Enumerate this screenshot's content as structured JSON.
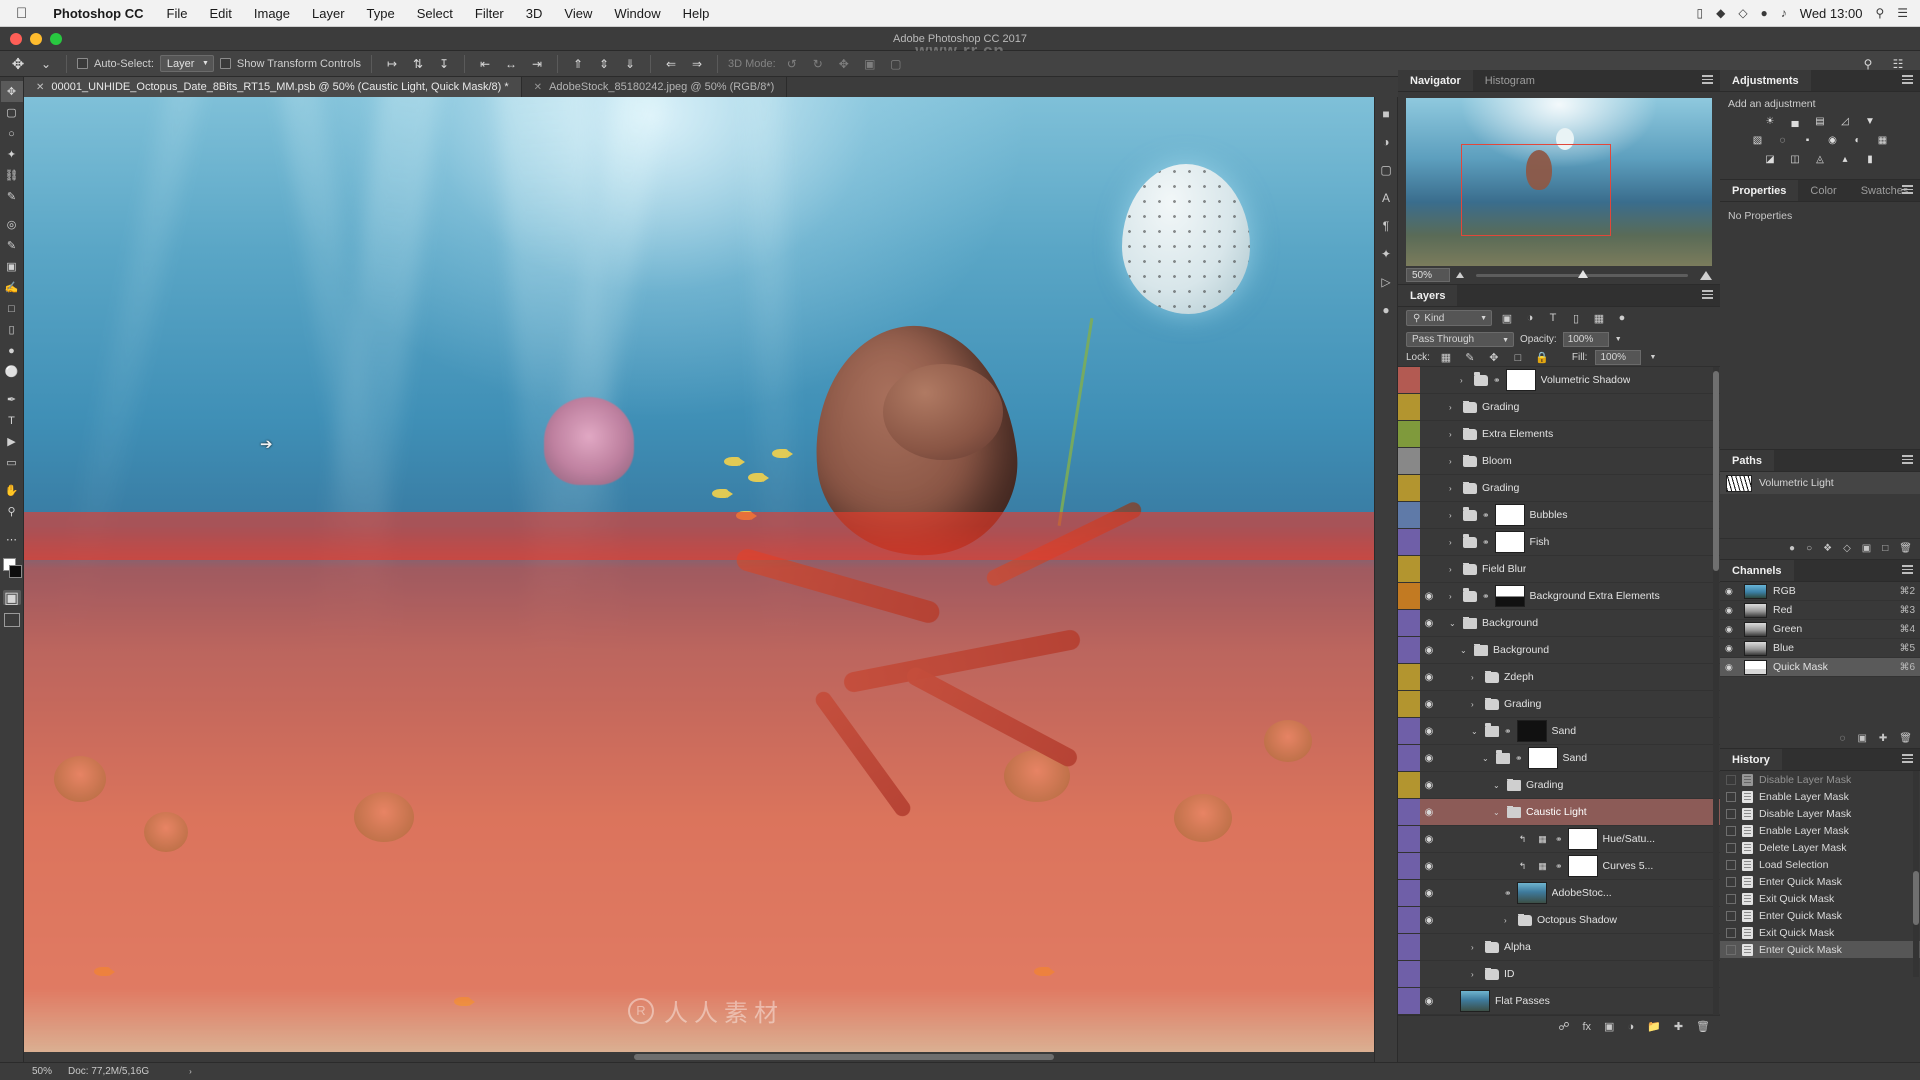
{
  "mac_menu": {
    "apple": "apple-logo",
    "app_name": "Photoshop CC",
    "items": [
      "File",
      "Edit",
      "Image",
      "Layer",
      "Type",
      "Select",
      "Filter",
      "3D",
      "View",
      "Window",
      "Help"
    ],
    "clock": "Wed 13:00",
    "status_icons": [
      "battery-icon",
      "wifi-icon",
      "volume-icon",
      "bluetooth-icon",
      "search-icon",
      "control-center-icon"
    ]
  },
  "window": {
    "title": "Adobe Photoshop CC 2017",
    "watermark_top": "www.rr.cn"
  },
  "options_bar": {
    "tool_icon": "move-tool-icon",
    "preset_caret": "chevron-down-icon",
    "auto_select_label": "Auto-Select:",
    "auto_select_value": "Layer",
    "show_transform_label": "Show Transform Controls",
    "align_icons": [
      "align-top-edges-icon",
      "align-vertical-centers-icon",
      "align-bottom-edges-icon",
      "align-left-edges-icon",
      "align-horizontal-centers-icon",
      "align-right-edges-icon",
      "distribute-top-icon",
      "distribute-vertical-center-icon",
      "distribute-bottom-icon",
      "distribute-left-icon",
      "distribute-right-icon"
    ],
    "mode_3d_label": "3D Mode:",
    "mode_3d_icons": [
      "rotate-3d-icon",
      "roll-3d-icon",
      "drag-3d-icon",
      "slide-3d-icon",
      "scale-3d-icon"
    ],
    "right_icons": [
      "search-icon",
      "workspace-icon"
    ]
  },
  "document_tabs": [
    {
      "name": "00001_UNHIDE_Octopus_Date_8Bits_RT15_MM.psb @ 50% (Caustic Light, Quick Mask/8) *",
      "active": true
    },
    {
      "name": "AdobeStock_85180242.jpeg @ 50% (RGB/8*)",
      "active": false
    }
  ],
  "toolbar": {
    "tools": [
      "move-tool",
      "rectangular-marquee-tool",
      "lasso-tool",
      "quick-selection-tool",
      "crop-tool",
      "eyedropper-tool",
      "spot-healing-brush-tool",
      "brush-tool",
      "clone-stamp-tool",
      "history-brush-tool",
      "eraser-tool",
      "gradient-tool",
      "blur-tool",
      "dodge-tool",
      "pen-tool",
      "type-tool",
      "path-selection-tool",
      "rectangle-tool",
      "hand-tool",
      "zoom-tool",
      "edit-toolbar"
    ],
    "foreground_color": "#ffffff",
    "background_color": "#0d0d0d",
    "quick_mask_mode": "quick-mask-toggle",
    "screen_mode": "screen-mode-toggle"
  },
  "canvas": {
    "watermark": "人人素材",
    "watermark_mark": "R",
    "quick_mask_color": "#ec3a2a"
  },
  "dock_icons": [
    "color-panel-icon",
    "adjustments-panel-icon",
    "libraries-panel-icon",
    "character-panel-icon",
    "paragraph-panel-icon",
    "styles-panel-icon",
    "actions-panel-icon",
    "brush-panel-icon"
  ],
  "navigator": {
    "tabs": [
      {
        "label": "Navigator",
        "active": true
      },
      {
        "label": "Histogram",
        "active": false
      }
    ],
    "zoom_level": "50%",
    "zoom_out_icon": "zoom-out-icon",
    "zoom_in_icon": "zoom-in-icon",
    "view_box_color": "#e2473a"
  },
  "layers_panel": {
    "title": "Layers",
    "filter_label": "Kind",
    "filter_icons": [
      "filter-pixel-icon",
      "filter-adjustment-icon",
      "filter-type-icon",
      "filter-shape-icon",
      "filter-smartobject-icon",
      "filter-toggle-icon"
    ],
    "blend_mode": "Pass Through",
    "opacity_label": "Opacity:",
    "opacity_value": "100%",
    "lock_label": "Lock:",
    "lock_icons": [
      "lock-transparent-pixels-icon",
      "lock-image-pixels-icon",
      "lock-position-icon",
      "lock-artboard-nesting-icon",
      "lock-all-icon"
    ],
    "fill_label": "Fill:",
    "fill_value": "100%",
    "rows": [
      {
        "name": "Volumetric Shadow",
        "indent": 2,
        "color": "#b35a52",
        "visible": false,
        "type": "group",
        "thumb": "white-mask",
        "arrow": "›",
        "linked": true
      },
      {
        "name": "Grading",
        "indent": 1,
        "color": "#b3952f",
        "visible": false,
        "type": "group",
        "arrow": "›"
      },
      {
        "name": "Extra Elements",
        "indent": 1,
        "color": "#7f9a3c",
        "visible": false,
        "type": "group",
        "arrow": "›"
      },
      {
        "name": "Bloom",
        "indent": 1,
        "color": "#888888",
        "visible": false,
        "type": "group",
        "arrow": "›"
      },
      {
        "name": "Grading",
        "indent": 1,
        "color": "#b3952f",
        "visible": false,
        "type": "group",
        "arrow": "›"
      },
      {
        "name": "Bubbles",
        "indent": 1,
        "color": "#5f7aa8",
        "visible": false,
        "type": "group",
        "thumb": "white-mask",
        "arrow": "›",
        "linked": true
      },
      {
        "name": "Fish",
        "indent": 1,
        "color": "#6f5fa8",
        "visible": false,
        "type": "group",
        "thumb": "fish-mask",
        "arrow": "›",
        "linked": true
      },
      {
        "name": "Field Blur",
        "indent": 1,
        "color": "#b3952f",
        "visible": false,
        "type": "group",
        "arrow": "›"
      },
      {
        "name": "Background Extra Elements",
        "indent": 1,
        "color": "#c27a22",
        "visible": true,
        "type": "group",
        "thumb": "split-mask",
        "arrow": "›",
        "linked": true
      },
      {
        "name": "Background",
        "indent": 1,
        "color": "#6f5fa8",
        "visible": true,
        "type": "group-open",
        "arrow": "⌄"
      },
      {
        "name": "Background",
        "indent": 2,
        "color": "#6f5fa8",
        "visible": true,
        "type": "group-open",
        "arrow": "⌄"
      },
      {
        "name": "Zdeph",
        "indent": 3,
        "color": "#b3952f",
        "visible": true,
        "type": "group",
        "arrow": "›"
      },
      {
        "name": "Grading",
        "indent": 3,
        "color": "#b3952f",
        "visible": true,
        "type": "group",
        "arrow": "›"
      },
      {
        "name": "Sand",
        "indent": 3,
        "color": "#6f5fa8",
        "visible": true,
        "type": "group-open",
        "thumb": "black-mask",
        "arrow": "⌄",
        "linked": true
      },
      {
        "name": "Sand",
        "indent": 4,
        "color": "#6f5fa8",
        "visible": true,
        "type": "group-open",
        "thumb": "white-mask",
        "arrow": "⌄",
        "linked": true
      },
      {
        "name": "Grading",
        "indent": 5,
        "color": "#b3952f",
        "visible": true,
        "type": "group-open",
        "arrow": "⌄"
      },
      {
        "name": "Caustic Light",
        "indent": 5,
        "color": "#6f5fa8",
        "visible": true,
        "type": "group-open",
        "arrow": "⌄",
        "selected": true
      },
      {
        "name": "Hue/Satu...",
        "indent": 7,
        "color": "#6f5fa8",
        "visible": true,
        "type": "adjustment",
        "thumb": "white-mask",
        "linked": true
      },
      {
        "name": "Curves 5...",
        "indent": 7,
        "color": "#6f5fa8",
        "visible": true,
        "type": "adjustment",
        "thumb": "white-mask",
        "linked": true
      },
      {
        "name": "AdobeStoc...",
        "indent": 6,
        "color": "#6f5fa8",
        "visible": true,
        "type": "smartobject",
        "thumb": "photo",
        "linked": true
      },
      {
        "name": "Octopus Shadow",
        "indent": 6,
        "color": "#6f5fa8",
        "visible": true,
        "type": "group",
        "arrow": "›"
      },
      {
        "name": "Alpha",
        "indent": 3,
        "color": "#6f5fa8",
        "visible": false,
        "type": "group",
        "arrow": "›"
      },
      {
        "name": "ID",
        "indent": 3,
        "color": "#6f5fa8",
        "visible": false,
        "type": "group",
        "arrow": "›"
      },
      {
        "name": "Flat Passes",
        "indent": 2,
        "color": "#6f5fa8",
        "visible": true,
        "type": "layer",
        "thumb": "photo"
      }
    ],
    "footer_icons": [
      "link-layers-icon",
      "layer-style-icon",
      "add-layer-mask-icon",
      "new-fill-adjustment-icon",
      "new-group-icon",
      "new-layer-icon",
      "delete-layer-icon"
    ]
  },
  "adjustments_panel": {
    "title": "Adjustments",
    "subtitle": "Add an adjustment",
    "buttons": [
      [
        "brightness-contrast-icon",
        "levels-icon",
        "curves-icon",
        "exposure-icon",
        "vibrance-icon"
      ],
      [
        "hue-saturation-icon",
        "color-balance-icon",
        "black-white-icon",
        "photo-filter-icon",
        "channel-mixer-icon",
        "color-lookup-icon"
      ],
      [
        "invert-icon",
        "posterize-icon",
        "threshold-icon",
        "gradient-map-icon",
        "selective-color-icon"
      ]
    ]
  },
  "properties_panel": {
    "tabs": [
      {
        "label": "Properties",
        "active": true
      },
      {
        "label": "Color",
        "active": false
      },
      {
        "label": "Swatches",
        "active": false
      }
    ],
    "empty_message": "No Properties"
  },
  "paths_panel": {
    "title": "Paths",
    "rows": [
      {
        "name": "Volumetric Light"
      }
    ],
    "footer_icons": [
      "fill-path-icon",
      "stroke-path-icon",
      "load-selection-icon",
      "make-work-path-icon",
      "add-mask-icon",
      "new-path-icon",
      "delete-path-icon"
    ]
  },
  "channels_panel": {
    "title": "Channels",
    "rows": [
      {
        "name": "RGB",
        "shortcut": "⌘2",
        "visible": true,
        "selected": false,
        "thumb": "color"
      },
      {
        "name": "Red",
        "shortcut": "⌘3",
        "visible": true,
        "selected": false,
        "thumb": "gray"
      },
      {
        "name": "Green",
        "shortcut": "⌘4",
        "visible": true,
        "selected": false,
        "thumb": "gray"
      },
      {
        "name": "Blue",
        "shortcut": "⌘5",
        "visible": true,
        "selected": false,
        "thumb": "gray"
      },
      {
        "name": "Quick Mask",
        "shortcut": "⌘6",
        "visible": true,
        "selected": true,
        "thumb": "mask"
      }
    ],
    "footer_icons": [
      "load-channel-as-selection-icon",
      "save-selection-as-channel-icon",
      "new-channel-icon",
      "delete-channel-icon"
    ]
  },
  "history_panel": {
    "title": "History",
    "rows": [
      {
        "name": "Disable Layer Mask",
        "selected": false
      },
      {
        "name": "Enable Layer Mask",
        "selected": false
      },
      {
        "name": "Disable Layer Mask",
        "selected": false
      },
      {
        "name": "Enable Layer Mask",
        "selected": false
      },
      {
        "name": "Delete Layer Mask",
        "selected": false
      },
      {
        "name": "Load Selection",
        "selected": false
      },
      {
        "name": "Enter Quick Mask",
        "selected": false
      },
      {
        "name": "Exit Quick Mask",
        "selected": false
      },
      {
        "name": "Enter Quick Mask",
        "selected": false
      },
      {
        "name": "Exit Quick Mask",
        "selected": false
      },
      {
        "name": "Enter Quick Mask",
        "selected": true
      }
    ]
  },
  "status_bar": {
    "zoom": "50%",
    "doc_info": "Doc: 77,2M/5,16G",
    "caret": "›"
  }
}
